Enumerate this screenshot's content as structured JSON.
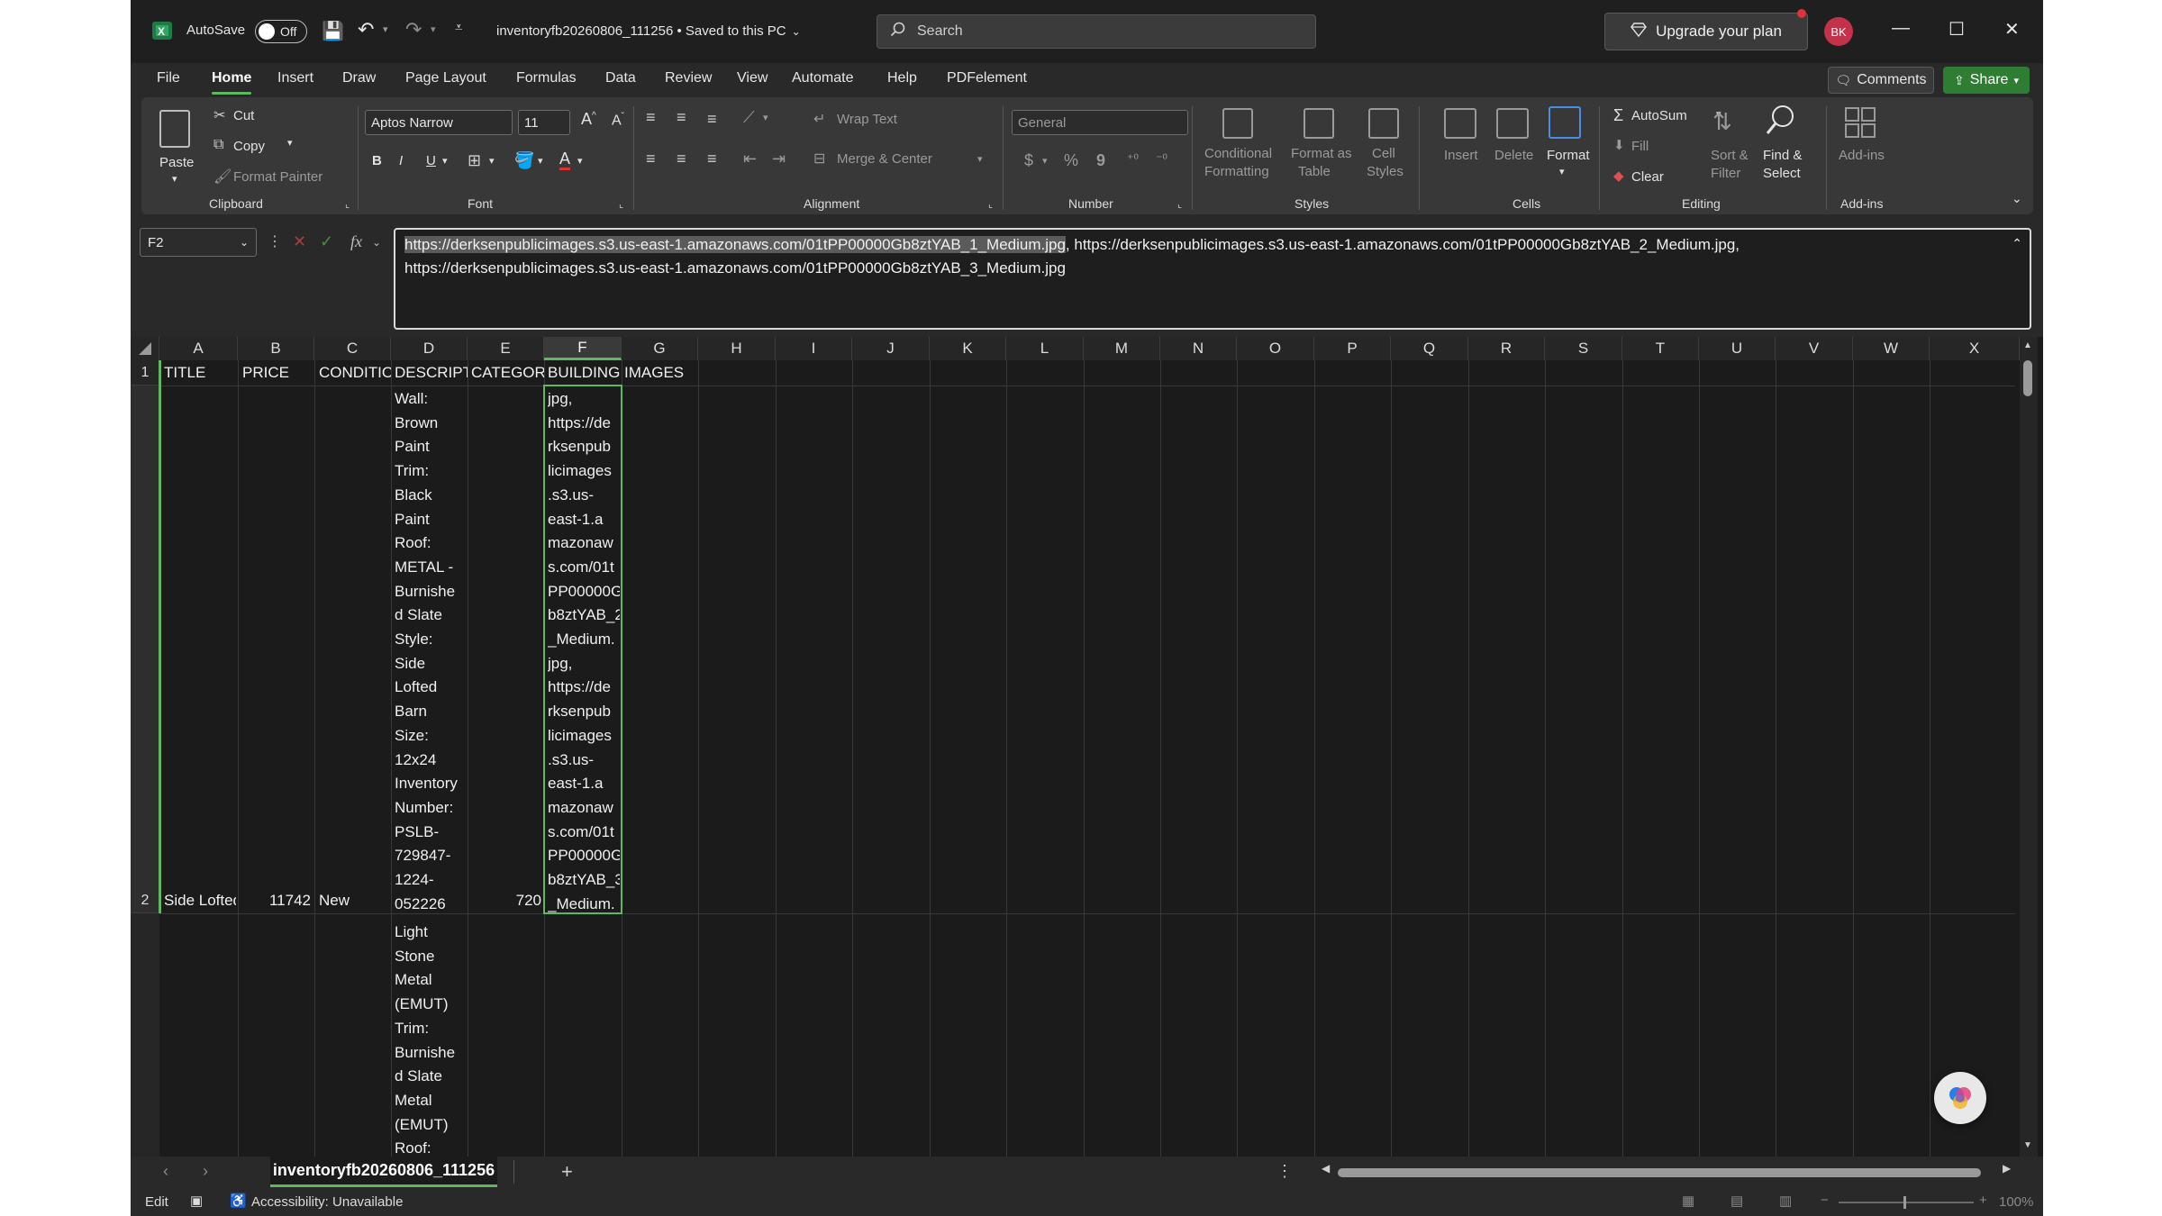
{
  "titlebar": {
    "autosave_label": "AutoSave",
    "autosave_state": "Off",
    "filename": "inventoryfb20260806_111256",
    "save_status": "• Saved to this PC",
    "search_placeholder": "Search",
    "upgrade_label": "Upgrade your plan",
    "user_initials": "BK"
  },
  "menu": {
    "items": [
      "File",
      "Home",
      "Insert",
      "Draw",
      "Page Layout",
      "Formulas",
      "Data",
      "Review",
      "View",
      "Automate",
      "Help",
      "PDFelement"
    ],
    "active": "Home",
    "comments_label": "Comments",
    "share_label": "Share"
  },
  "ribbon": {
    "clipboard": {
      "paste": "Paste",
      "cut": "Cut",
      "copy": "Copy",
      "format_painter": "Format Painter",
      "group": "Clipboard"
    },
    "font": {
      "family": "Aptos Narrow",
      "size": "11",
      "bold": "B",
      "italic": "I",
      "underline": "U",
      "group": "Font"
    },
    "alignment": {
      "wrap_text": "Wrap Text",
      "merge_center": "Merge & Center",
      "group": "Alignment"
    },
    "number": {
      "format": "General",
      "currency": "$",
      "percent": "%",
      "comma": "9",
      "group": "Number"
    },
    "styles": {
      "conditional_1": "Conditional",
      "conditional_2": "Formatting",
      "format_table_1": "Format as",
      "format_table_2": "Table",
      "cell_styles_1": "Cell",
      "cell_styles_2": "Styles",
      "group": "Styles"
    },
    "cells": {
      "insert": "Insert",
      "delete": "Delete",
      "format": "Format",
      "group": "Cells"
    },
    "editing": {
      "autosum": "AutoSum",
      "fill": "Fill",
      "clear": "Clear",
      "sort_1": "Sort &",
      "sort_2": "Filter",
      "find_1": "Find &",
      "find_2": "Select",
      "group": "Editing"
    },
    "addins": {
      "label": "Add-ins",
      "group": "Add-ins"
    }
  },
  "formula_bar": {
    "cell_ref": "F2",
    "fx": "fx",
    "line1_selected": "https://derksenpublicimages.s3.us-east-1.amazonaws.com/01tPP00000Gb8ztYAB_1_Medium.jpg",
    "line1_rest": ", https://derksenpublicimages.s3.us-east-1.amazonaws.com/01tPP00000Gb8ztYAB_2_Medium.jpg,",
    "line2": "https://derksenpublicimages.s3.us-east-1.amazonaws.com/01tPP00000Gb8ztYAB_3_Medium.jpg"
  },
  "grid": {
    "columns": [
      "A",
      "B",
      "C",
      "D",
      "E",
      "F",
      "G",
      "H",
      "I",
      "J",
      "K",
      "L",
      "M",
      "N",
      "O",
      "P",
      "Q",
      "R",
      "S",
      "T",
      "U",
      "V",
      "W",
      "X"
    ],
    "selected_column": "F",
    "row_numbers": [
      "1",
      "2"
    ],
    "row1": {
      "A": "TITLE",
      "B": "PRICE",
      "C": "CONDITIO",
      "D": "DESCRIPTI",
      "E": "CATEGORY",
      "F": "BUILDING IMAGES"
    },
    "row2": {
      "A": "Side Lofted",
      "B": "11742",
      "C": "New",
      "D": "Wall:\nBrown\nPaint\nTrim:\nBlack\nPaint\nRoof:\nMETAL -\nBurnishe\nd Slate\nStyle:\nSide\nLofted\nBarn\nSize:\n12x24\nInventory\nNumber:\nPSLB-\n729847-\n1224-\n052226",
      "E": "720",
      "F": "jpg,\nhttps://de\nrksenpub\nlicimages\n.s3.us-\neast-1.a\nmazonaw\ns.com/01t\nPP00000G\nb8ztYAB_2\n_Medium.\njpg,\nhttps://de\nrksenpub\nlicimages\n.s3.us-\neast-1.a\nmazonaw\ns.com/01t\nPP00000G\nb8ztYAB_3\n_Medium."
    },
    "row3": {
      "D": "Light\nStone\nMetal\n(EMUT)\nTrim:\nBurnishe\nd Slate\nMetal\n(EMUT)\nRoof:"
    }
  },
  "sheet_tab": "inventoryfb20260806_111256",
  "status": {
    "mode": "Edit",
    "accessibility": "Accessibility: Unavailable",
    "zoom": "100%"
  },
  "colors": {
    "accent": "#5fb85f",
    "share_green": "#2e7d32",
    "avatar": "#c4314b",
    "font_color_bar": "#e03030"
  }
}
